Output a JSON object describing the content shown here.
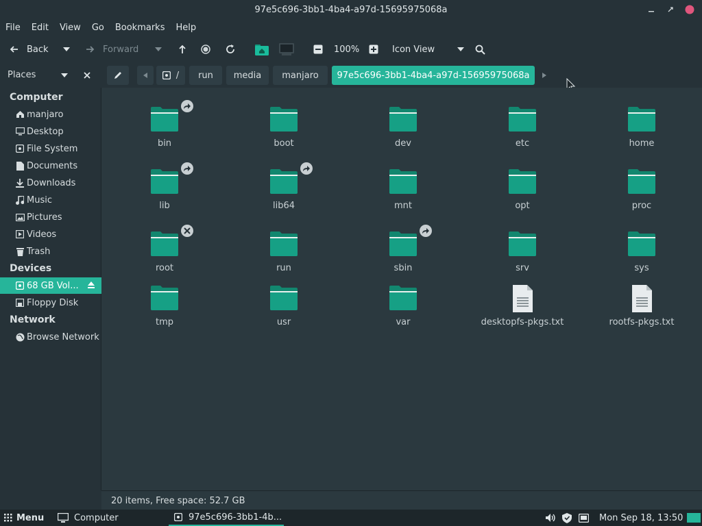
{
  "window": {
    "title": "97e5c696-3bb1-4ba4-a97d-15695975068a"
  },
  "menubar": [
    "File",
    "Edit",
    "View",
    "Go",
    "Bookmarks",
    "Help"
  ],
  "toolbar": {
    "back_label": "Back",
    "forward_label": "Forward",
    "zoom": "100%",
    "view_mode": "Icon View"
  },
  "places": {
    "title": "Places"
  },
  "breadcrumbs": [
    "/",
    "run",
    "media",
    "manjaro",
    "97e5c696-3bb1-4ba4-a97d-15695975068a"
  ],
  "sidebar": {
    "computer_label": "Computer",
    "devices_label": "Devices",
    "network_label": "Network",
    "computer": [
      "manjaro",
      "Desktop",
      "File System",
      "Documents",
      "Downloads",
      "Music",
      "Pictures",
      "Videos",
      "Trash"
    ],
    "devices": [
      "68 GB Vol...",
      "Floppy Disk"
    ],
    "network": [
      "Browse Network"
    ]
  },
  "items": [
    {
      "name": "bin",
      "type": "folder",
      "emblem": "symlink"
    },
    {
      "name": "boot",
      "type": "folder"
    },
    {
      "name": "dev",
      "type": "folder"
    },
    {
      "name": "etc",
      "type": "folder"
    },
    {
      "name": "home",
      "type": "folder"
    },
    {
      "name": "lib",
      "type": "folder",
      "emblem": "symlink"
    },
    {
      "name": "lib64",
      "type": "folder",
      "emblem": "symlink"
    },
    {
      "name": "mnt",
      "type": "folder"
    },
    {
      "name": "opt",
      "type": "folder"
    },
    {
      "name": "proc",
      "type": "folder"
    },
    {
      "name": "root",
      "type": "folder",
      "emblem": "locked"
    },
    {
      "name": "run",
      "type": "folder"
    },
    {
      "name": "sbin",
      "type": "folder",
      "emblem": "symlink"
    },
    {
      "name": "srv",
      "type": "folder"
    },
    {
      "name": "sys",
      "type": "folder"
    },
    {
      "name": "tmp",
      "type": "folder"
    },
    {
      "name": "usr",
      "type": "folder"
    },
    {
      "name": "var",
      "type": "folder"
    },
    {
      "name": "desktopfs-pkgs.txt",
      "type": "text"
    },
    {
      "name": "rootfs-pkgs.txt",
      "type": "text"
    }
  ],
  "status": {
    "text": "20 items, Free space: 52.7 GB"
  },
  "taskbar": {
    "menu_label": "Menu",
    "computer_label": "Computer",
    "window_label": "97e5c696-3bb1-4b...",
    "clock": "Mon Sep 18, 13:50"
  },
  "colors": {
    "accent": "#26b59a",
    "folder": "#16a085",
    "background": "#2b393f"
  }
}
